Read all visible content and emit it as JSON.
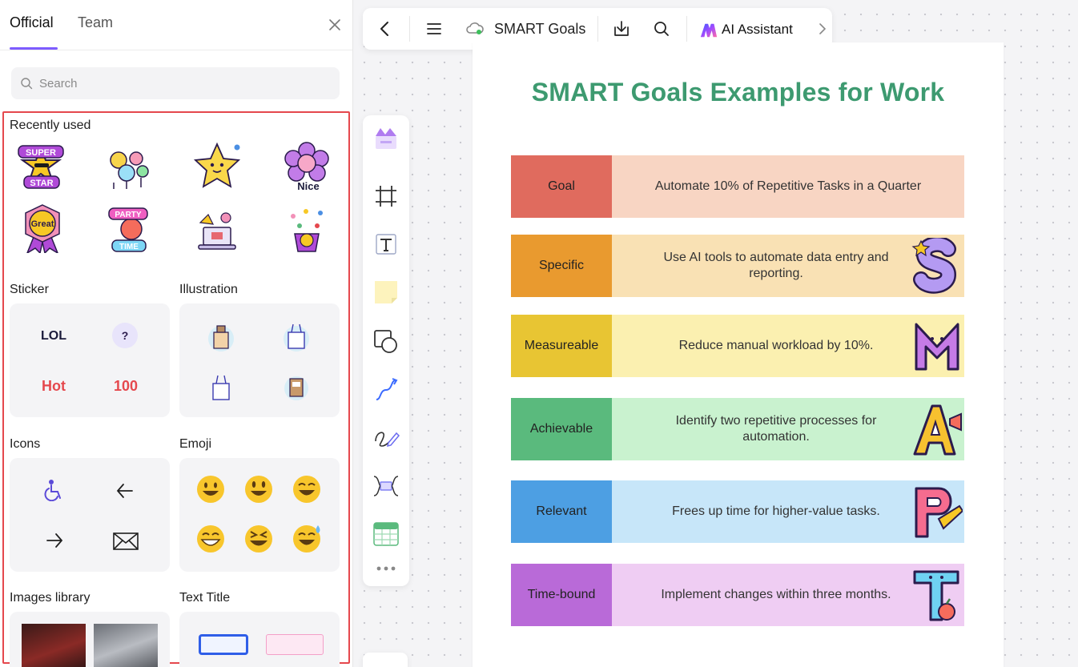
{
  "panel": {
    "tabs": [
      {
        "label": "Official"
      },
      {
        "label": "Team"
      }
    ],
    "search_placeholder": "Search",
    "recently_used": {
      "title": "Recently used",
      "stickers": [
        {
          "text": "SUPER STAR"
        },
        {
          "text": ""
        },
        {
          "text": ""
        },
        {
          "text": "Nice"
        },
        {
          "text": "Great"
        },
        {
          "text": "PARTY TIME"
        },
        {
          "text": ""
        },
        {
          "text": ""
        }
      ]
    },
    "sections": {
      "sticker": {
        "title": "Sticker",
        "items": [
          "LOL",
          "?",
          "Hot",
          "100"
        ]
      },
      "illustration": {
        "title": "Illustration"
      },
      "icons": {
        "title": "Icons"
      },
      "emoji": {
        "title": "Emoji"
      },
      "images": {
        "title": "Images library"
      },
      "text_title": {
        "title": "Text Title"
      }
    }
  },
  "topbar": {
    "doc_title": "SMART Goals",
    "ai_label": "AI Assistant"
  },
  "document": {
    "heading": "SMART Goals Examples for Work",
    "rows": [
      {
        "label": "Goal",
        "text": "Automate 10% of Repetitive Tasks in a Quarter",
        "label_color": "#e06b5e",
        "body_color": "#f8d5c3",
        "letter": ""
      },
      {
        "label": "Specific",
        "text": "Use AI tools to automate data entry and reporting.",
        "label_color": "#e99a2f",
        "body_color": "#f9e1b4",
        "letter": "S"
      },
      {
        "label": "Measureable",
        "text": "Reduce manual workload by 10%.",
        "label_color": "#e8c533",
        "body_color": "#fbf0b0",
        "letter": "M"
      },
      {
        "label": "Achievable",
        "text": "Identify two repetitive processes for automation.",
        "label_color": "#5aba7d",
        "body_color": "#c9f2cf",
        "letter": "A"
      },
      {
        "label": "Relevant",
        "text": "Frees up time for higher-value tasks.",
        "label_color": "#4d9fe3",
        "body_color": "#c7e6f9",
        "letter": "R"
      },
      {
        "label": "Time-bound",
        "text": "Implement changes within three months.",
        "label_color": "#b96ad8",
        "body_color": "#efcdf3",
        "letter": "T"
      }
    ]
  },
  "colors": {
    "accent": "#7d5cff",
    "heading_green": "#3d9a70",
    "highlight_red": "#e5484d"
  }
}
